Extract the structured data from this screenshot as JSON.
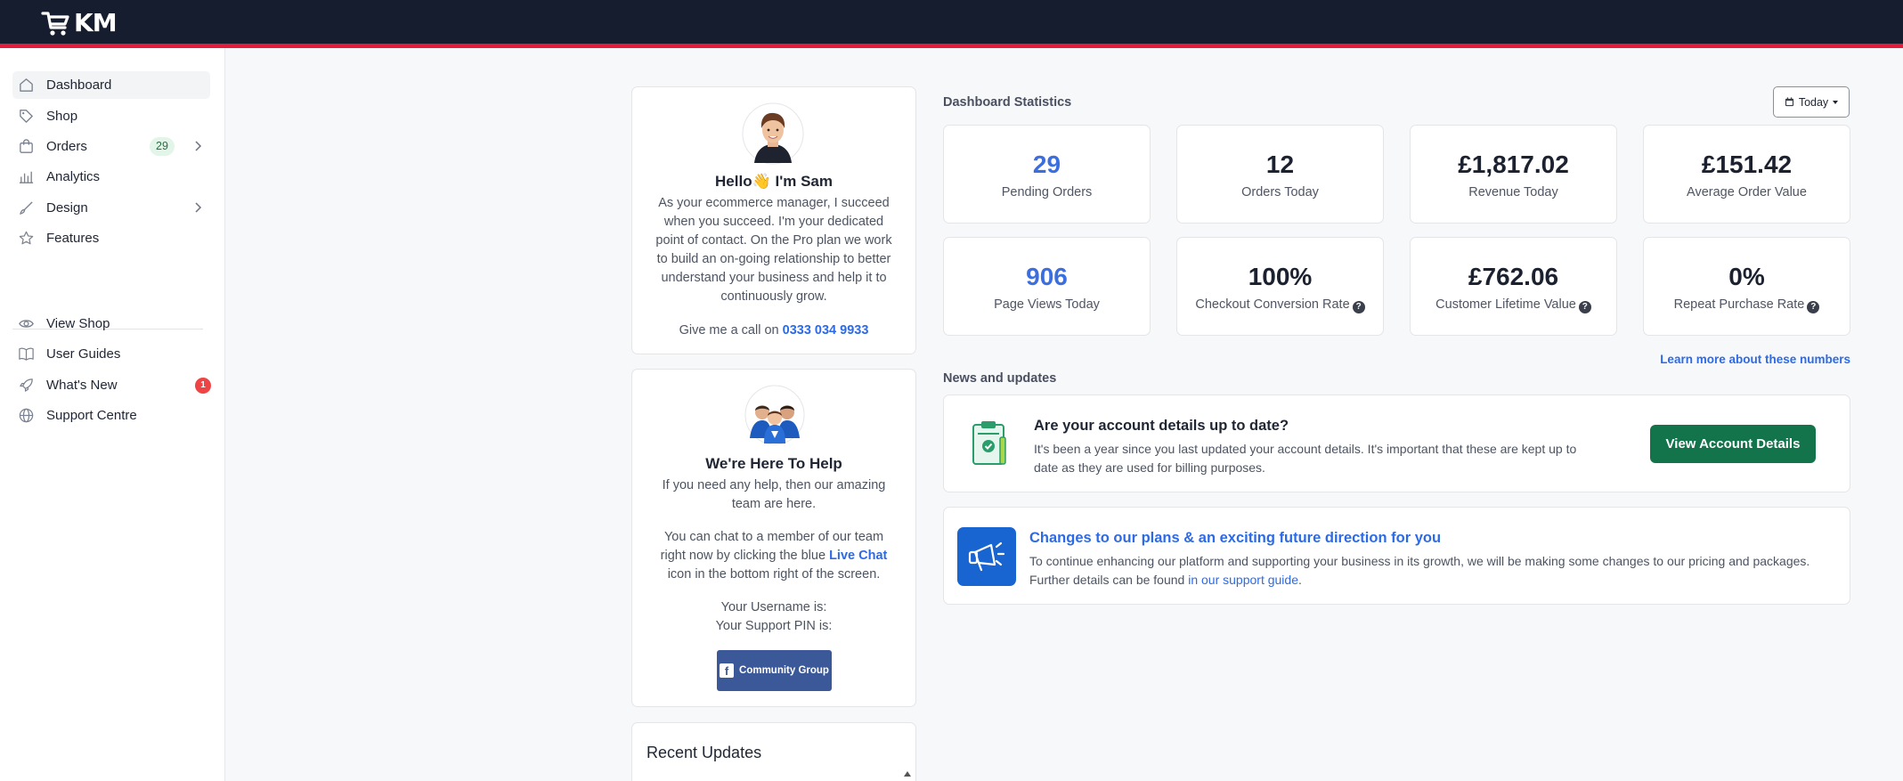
{
  "brand": {
    "logo_text": "KM"
  },
  "sidebar": {
    "items": [
      {
        "label": "Dashboard",
        "icon": "home-icon"
      },
      {
        "label": "Shop",
        "icon": "tag-icon"
      },
      {
        "label": "Orders",
        "icon": "bag-icon",
        "badge": "29"
      },
      {
        "label": "Analytics",
        "icon": "chart-icon"
      },
      {
        "label": "Design",
        "icon": "brush-icon"
      },
      {
        "label": "Features",
        "icon": "star-icon"
      }
    ],
    "secondary": [
      {
        "label": "View Shop",
        "icon": "eye-icon"
      },
      {
        "label": "User Guides",
        "icon": "book-icon"
      },
      {
        "label": "What's New",
        "icon": "rocket-icon",
        "badge": "1"
      },
      {
        "label": "Support Centre",
        "icon": "globe-icon"
      }
    ]
  },
  "manager": {
    "greeting": "Hello👋 I'm Sam",
    "bio": "As your ecommerce manager, I succeed when you succeed. I'm your dedicated point of contact. On the Pro plan we work to build an on-going relationship to better understand your business and help it to continuously grow.",
    "call_text": "Give me a call on",
    "phone": "0333 034 9933"
  },
  "help": {
    "title": "We're Here To Help",
    "text1": "If you need any help, then our amazing team are here.",
    "text2_before": "You can chat to a member of our team right now by clicking the blue",
    "text2_link": "Live Chat",
    "text2_after": "icon in the bottom right of the screen.",
    "username": "Your Username is:",
    "pin": "Your Support PIN is:",
    "community_button": "Community Group"
  },
  "recent": {
    "title": "Recent Updates"
  },
  "stats": {
    "title": "Dashboard Statistics",
    "filter_label": "Today",
    "cards": [
      {
        "value": "29",
        "label": "Pending Orders"
      },
      {
        "value": "12",
        "label": "Orders Today"
      },
      {
        "value": "£1,817.02",
        "label": "Revenue Today"
      },
      {
        "value": "£151.42",
        "label": "Average Order Value"
      },
      {
        "value": "906",
        "label": "Page Views Today"
      },
      {
        "value": "100%",
        "label": "Checkout Conversion Rate"
      },
      {
        "value": "£762.06",
        "label": "Customer Lifetime Value"
      },
      {
        "value": "0%",
        "label": "Repeat Purchase Rate"
      }
    ],
    "learn_more": "Learn more about these numbers"
  },
  "news": {
    "title": "News and updates",
    "account": {
      "heading": "Are your account details up to date?",
      "body": "It's been a year since you last updated your account details. It's important that these are kept up to date as they are used for billing purposes.",
      "button": "View Account Details"
    },
    "plans": {
      "heading": "Changes to our plans & an exciting future direction for you",
      "body": "To continue enhancing our platform and supporting your business in its growth, we will be making some changes to our pricing and packages. Further details can be found",
      "link": "in our support guide",
      "end": "."
    }
  },
  "colors": {
    "topbar": "#161d2e",
    "accent_red": "#e21c3c",
    "link_blue": "#2d6ae6",
    "green_button": "#13734b"
  }
}
